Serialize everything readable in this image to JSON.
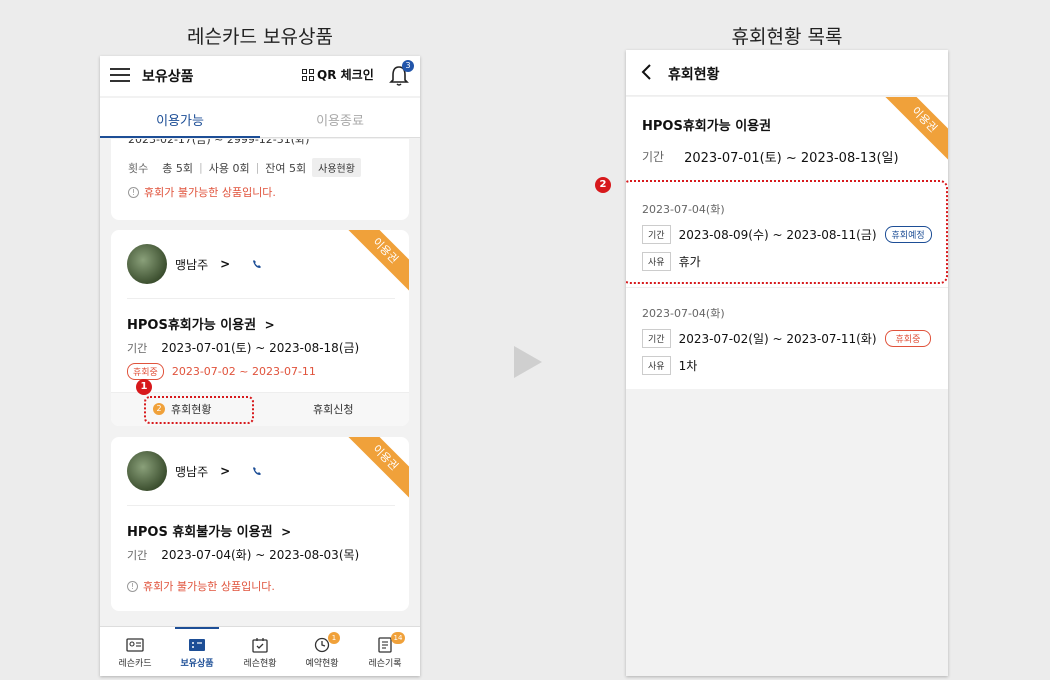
{
  "captions": {
    "left": "레슨카드 보유상품",
    "right": "휴회현황 목록"
  },
  "left": {
    "header": {
      "title": "보유상품",
      "qr_label": "QR 체크인",
      "notif_count": "3"
    },
    "tabs": {
      "active": "이용가능",
      "inactive": "이용종료"
    },
    "card1": {
      "clipped_period": "2023-02-17(금) ~ 2999-12-31(화)",
      "count_label": "횟수",
      "total": "총 5회",
      "used": "사용 0회",
      "remain": "잔여 5회",
      "usage_button": "사용현황",
      "warning": "휴회가 불가능한 상품입니다."
    },
    "card2": {
      "ribbon": "이용권",
      "trainer": "맹남주",
      "product": "HPOS휴회가능 이용권",
      "period_label": "기간",
      "period": "2023-07-01(토) ~ 2023-08-18(금)",
      "status_pill": "휴회중",
      "status_range": "2023-07-02 ~ 2023-07-11",
      "action1_count": "2",
      "action1": "휴회현황",
      "action2": "휴회신청"
    },
    "card3": {
      "ribbon": "이용권",
      "trainer": "맹남주",
      "product": "HPOS 휴회불가능 이용권",
      "period_label": "기간",
      "period": "2023-07-04(화) ~ 2023-08-03(목)",
      "warning": "휴회가 불가능한 상품입니다."
    },
    "step1": "1",
    "nav": [
      {
        "label": "레슨카드",
        "icon": "lesson-card-icon"
      },
      {
        "label": "보유상품",
        "icon": "ticket-icon"
      },
      {
        "label": "레슨현황",
        "icon": "calendar-check-icon"
      },
      {
        "label": "예약현황",
        "icon": "clock-icon",
        "badge": "1"
      },
      {
        "label": "레슨기록",
        "icon": "note-icon",
        "badge": "14"
      }
    ]
  },
  "right": {
    "header": {
      "title": "휴회현황"
    },
    "ribbon": "이용권",
    "product": "HPOS휴회가능 이용권",
    "period_label": "기간",
    "period": "2023-07-01(토) ~ 2023-08-13(일)",
    "step2": "2",
    "history": [
      {
        "date": "2023-07-04(화)",
        "period_tag": "기간",
        "period": "2023-08-09(수) ~ 2023-08-11(금)",
        "status": "휴회예정",
        "reason_tag": "사유",
        "reason": "휴가"
      },
      {
        "date": "2023-07-04(화)",
        "period_tag": "기간",
        "period": "2023-07-02(일) ~ 2023-07-11(화)",
        "status": "휴회중",
        "reason_tag": "사유",
        "reason": "1차"
      }
    ]
  }
}
